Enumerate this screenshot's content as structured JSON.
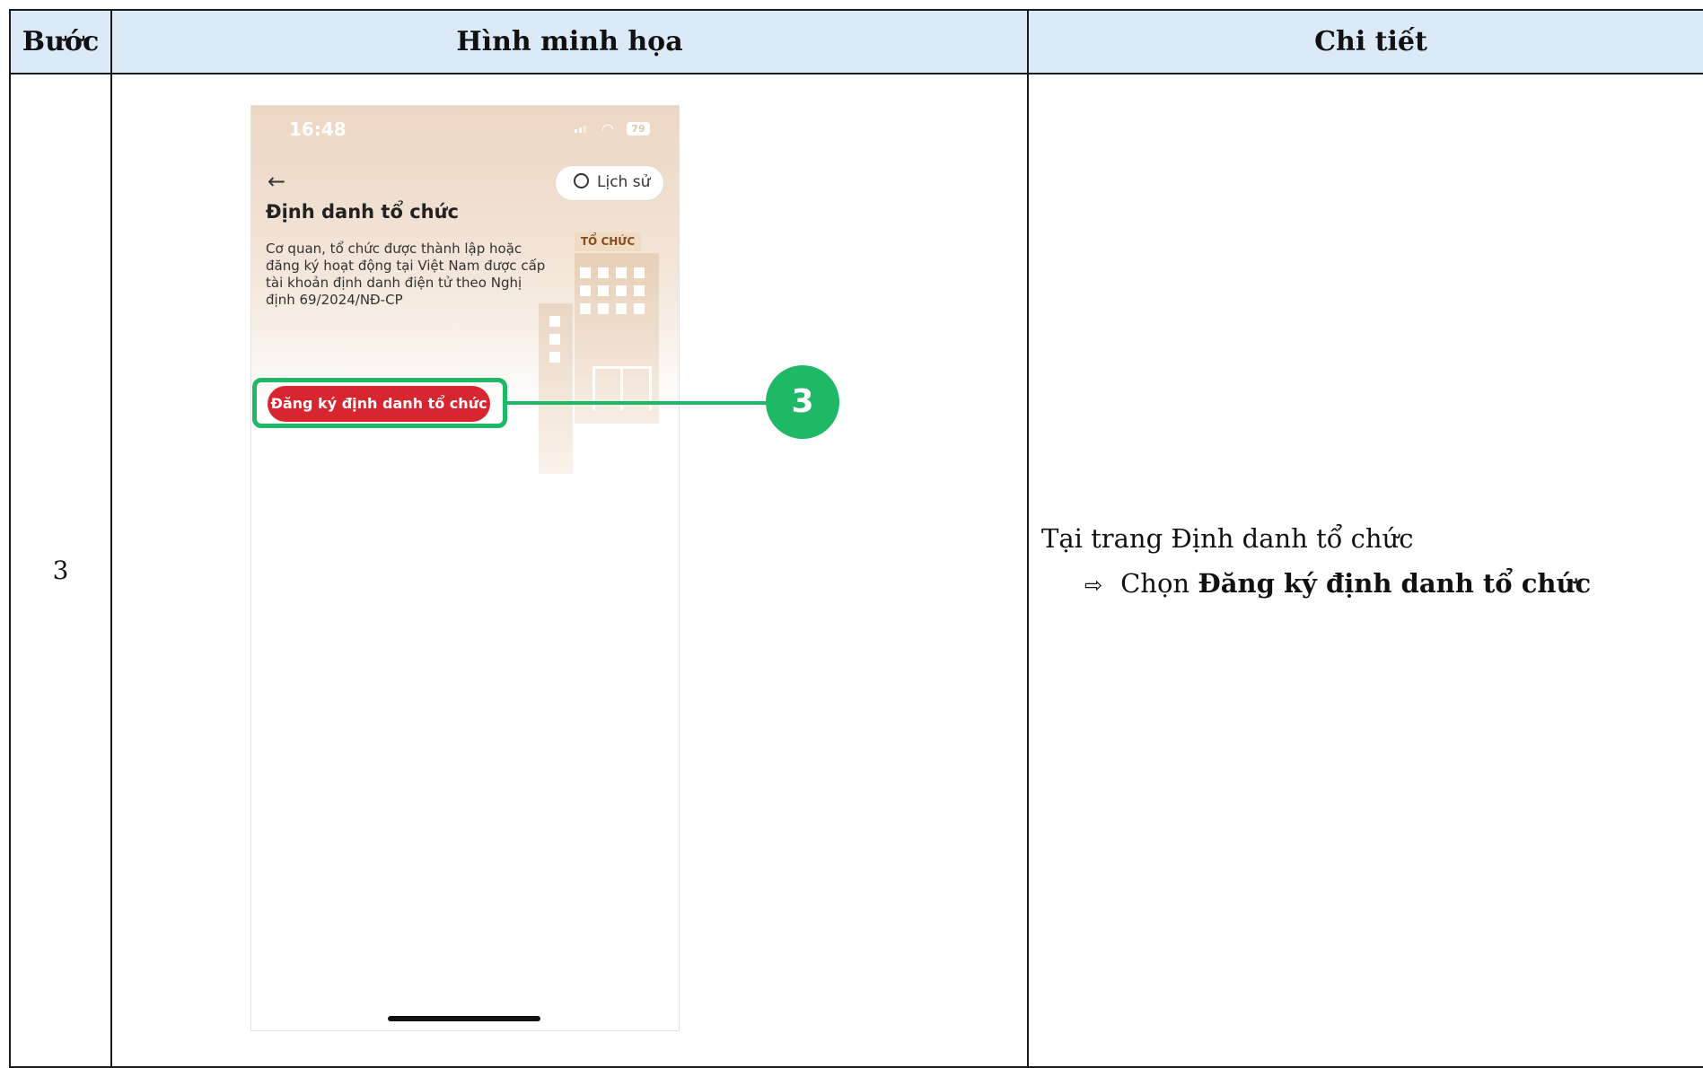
{
  "table": {
    "headers": [
      "Bước",
      "Hình minh họa",
      "Chi tiết"
    ],
    "step": "3"
  },
  "phone": {
    "time": "16:48",
    "battery": "79",
    "history_label": "Lịch sử",
    "title": "Định danh tổ chức",
    "description": "Cơ quan, tổ chức được thành lập hoặc đăng ký hoạt động tại Việt Nam được cấp tài khoản định danh điện tử theo Nghị định 69/2024/NĐ-CP",
    "building_sign": "TỔ CHỨC",
    "register_button": "Đăng ký định danh tổ chức"
  },
  "callout": "3",
  "detail": {
    "line": "Tại trang Định danh tổ chức",
    "arrow": "⇨",
    "action_prefix": "Chọn ",
    "action_bold": "Đăng ký định danh tổ chức"
  },
  "colors": {
    "header_bg": "#dceaf7",
    "highlight": "#1fb866",
    "button": "#d7262f"
  }
}
